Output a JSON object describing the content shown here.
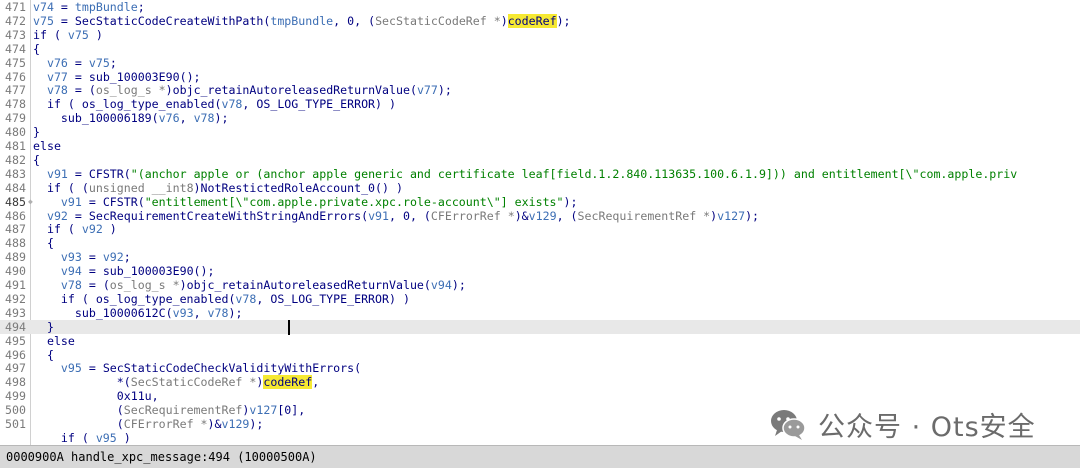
{
  "editor": {
    "lines": [
      {
        "n": "471",
        "t": [
          [
            "v",
            "v74"
          ],
          [
            "k",
            " = "
          ],
          [
            "v",
            "tmpBundle"
          ],
          [
            "k",
            ";"
          ]
        ]
      },
      {
        "n": "472",
        "t": [
          [
            "v",
            "v75"
          ],
          [
            "k",
            " = SecStaticCodeCreateWithPath("
          ],
          [
            "v",
            "tmpBundle"
          ],
          [
            "k",
            ", 0, ("
          ],
          [
            "t",
            "SecStaticCodeRef *"
          ],
          [
            "k",
            ")"
          ],
          [
            "hl",
            "codeRef"
          ],
          [
            "k",
            ");"
          ]
        ]
      },
      {
        "n": "473",
        "t": [
          [
            "k",
            "if ( "
          ],
          [
            "v",
            "v75"
          ],
          [
            "k",
            " )"
          ]
        ]
      },
      {
        "n": "474",
        "t": [
          [
            "k",
            "{"
          ]
        ]
      },
      {
        "n": "475",
        "t": [
          [
            "k",
            "  "
          ],
          [
            "v",
            "v76"
          ],
          [
            "k",
            " = "
          ],
          [
            "v",
            "v75"
          ],
          [
            "k",
            ";"
          ]
        ]
      },
      {
        "n": "476",
        "t": [
          [
            "k",
            "  "
          ],
          [
            "v",
            "v77"
          ],
          [
            "k",
            " = sub_100003E90();"
          ]
        ]
      },
      {
        "n": "477",
        "t": [
          [
            "k",
            "  "
          ],
          [
            "v",
            "v78"
          ],
          [
            "k",
            " = ("
          ],
          [
            "t",
            "os_log_s *"
          ],
          [
            "k",
            ")objc_retainAutoreleasedReturnValue("
          ],
          [
            "v",
            "v77"
          ],
          [
            "k",
            ");"
          ]
        ]
      },
      {
        "n": "478",
        "t": [
          [
            "k",
            "  if ( os_log_type_enabled("
          ],
          [
            "v",
            "v78"
          ],
          [
            "k",
            ", OS_LOG_TYPE_ERROR) )"
          ]
        ]
      },
      {
        "n": "479",
        "t": [
          [
            "k",
            "    sub_100006189("
          ],
          [
            "v",
            "v76"
          ],
          [
            "k",
            ", "
          ],
          [
            "v",
            "v78"
          ],
          [
            "k",
            ");"
          ]
        ]
      },
      {
        "n": "480",
        "t": [
          [
            "k",
            "}"
          ]
        ]
      },
      {
        "n": "481",
        "t": [
          [
            "k",
            "else"
          ]
        ]
      },
      {
        "n": "482",
        "t": [
          [
            "k",
            "{"
          ]
        ]
      },
      {
        "n": "483",
        "t": [
          [
            "k",
            "  "
          ],
          [
            "v",
            "v91"
          ],
          [
            "k",
            " = CFSTR("
          ],
          [
            "s",
            "\"(anchor apple or (anchor apple generic and certificate leaf[field.1.2.840.113635.100.6.1.9])) and entitlement[\\\"com.apple.priv"
          ]
        ]
      },
      {
        "n": "484",
        "t": [
          [
            "k",
            "  if ( ("
          ],
          [
            "t",
            "unsigned __int8"
          ],
          [
            "k",
            ")NotRestictedRoleAccount_0() )"
          ]
        ]
      },
      {
        "n": "485",
        "mark": true,
        "t": [
          [
            "k",
            "    "
          ],
          [
            "v",
            "v91"
          ],
          [
            "k",
            " = CFSTR("
          ],
          [
            "s",
            "\"entitlement[\\\"com.apple.private.xpc.role-account\\\"] exists\""
          ],
          [
            "k",
            ");"
          ]
        ]
      },
      {
        "n": "486",
        "t": [
          [
            "k",
            "  "
          ],
          [
            "v",
            "v92"
          ],
          [
            "k",
            " = SecRequirementCreateWithStringAndErrors("
          ],
          [
            "v",
            "v91"
          ],
          [
            "k",
            ", 0, ("
          ],
          [
            "t",
            "CFErrorRef *"
          ],
          [
            "k",
            ")&"
          ],
          [
            "v",
            "v129"
          ],
          [
            "k",
            ", ("
          ],
          [
            "t",
            "SecRequirementRef *"
          ],
          [
            "k",
            ")"
          ],
          [
            "v",
            "v127"
          ],
          [
            "k",
            ");"
          ]
        ]
      },
      {
        "n": "487",
        "t": [
          [
            "k",
            "  if ( "
          ],
          [
            "v",
            "v92"
          ],
          [
            "k",
            " )"
          ]
        ]
      },
      {
        "n": "488",
        "t": [
          [
            "k",
            "  {"
          ]
        ]
      },
      {
        "n": "489",
        "t": [
          [
            "k",
            "    "
          ],
          [
            "v",
            "v93"
          ],
          [
            "k",
            " = "
          ],
          [
            "v",
            "v92"
          ],
          [
            "k",
            ";"
          ]
        ]
      },
      {
        "n": "490",
        "t": [
          [
            "k",
            "    "
          ],
          [
            "v",
            "v94"
          ],
          [
            "k",
            " = sub_100003E90();"
          ]
        ]
      },
      {
        "n": "491",
        "t": [
          [
            "k",
            "    "
          ],
          [
            "v",
            "v78"
          ],
          [
            "k",
            " = ("
          ],
          [
            "t",
            "os_log_s *"
          ],
          [
            "k",
            ")objc_retainAutoreleasedReturnValue("
          ],
          [
            "v",
            "v94"
          ],
          [
            "k",
            ");"
          ]
        ]
      },
      {
        "n": "492",
        "t": [
          [
            "k",
            "    if ( os_log_type_enabled("
          ],
          [
            "v",
            "v78"
          ],
          [
            "k",
            ", OS_LOG_TYPE_ERROR) )"
          ]
        ]
      },
      {
        "n": "493",
        "t": [
          [
            "k",
            "      sub_10000612C("
          ],
          [
            "v",
            "v93"
          ],
          [
            "k",
            ", "
          ],
          [
            "v",
            "v78"
          ],
          [
            "k",
            ");"
          ]
        ]
      },
      {
        "n": "494",
        "cur": true,
        "t": [
          [
            "k",
            "  }"
          ]
        ]
      },
      {
        "n": "495",
        "t": [
          [
            "k",
            "  else"
          ]
        ]
      },
      {
        "n": "496",
        "t": [
          [
            "k",
            "  {"
          ]
        ]
      },
      {
        "n": "497",
        "t": [
          [
            "k",
            "    "
          ],
          [
            "v",
            "v95"
          ],
          [
            "k",
            " = SecStaticCodeCheckValidityWithErrors("
          ]
        ]
      },
      {
        "n": "498",
        "t": [
          [
            "k",
            "            *("
          ],
          [
            "t",
            "SecStaticCodeRef *"
          ],
          [
            "k",
            ")"
          ],
          [
            "hl",
            "codeRef"
          ],
          [
            "k",
            ","
          ]
        ]
      },
      {
        "n": "499",
        "t": [
          [
            "k",
            "            0x11u,"
          ]
        ]
      },
      {
        "n": "500",
        "t": [
          [
            "k",
            "            ("
          ],
          [
            "t",
            "SecRequirementRef"
          ],
          [
            "k",
            ")"
          ],
          [
            "v",
            "v127"
          ],
          [
            "k",
            "[0],"
          ]
        ]
      },
      {
        "n": "501",
        "t": [
          [
            "k",
            "            ("
          ],
          [
            "t",
            "CFErrorRef *"
          ],
          [
            "k",
            ")&"
          ],
          [
            "v",
            "v129"
          ],
          [
            "k",
            ");"
          ]
        ]
      },
      {
        "n": "",
        "t": [
          [
            "k",
            "    if ( "
          ],
          [
            "v",
            "v95"
          ],
          [
            "k",
            " )"
          ]
        ]
      }
    ]
  },
  "watermark": {
    "icon": "wechat-icon",
    "text": "公众号 · Ots安全"
  },
  "statusbar": {
    "text": "0000900A handle_xpc_message:494 (10000500A)"
  }
}
